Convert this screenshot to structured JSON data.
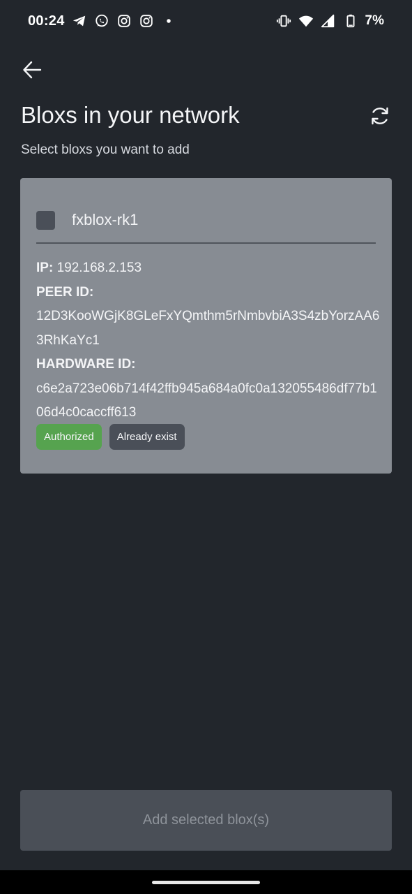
{
  "status_bar": {
    "time": "00:24",
    "left_icons": [
      "telegram-icon",
      "whatsapp-icon",
      "instagram-icon",
      "instagram-icon",
      "dot-icon"
    ],
    "right_icons": [
      "vibrate-icon",
      "wifi-icon",
      "signal-icon",
      "battery-icon"
    ],
    "battery": "7%"
  },
  "header": {
    "title": "Bloxs in your network",
    "subtitle": "Select bloxs you want to add"
  },
  "blox": {
    "name": "fxblox-rk1",
    "checked": false,
    "ip_label": "IP:",
    "ip": "192.168.2.153",
    "peer_label": "PEER ID:",
    "peer_id": "12D3KooWGjK8GLeFxYQmthm5rNmbvbiA3S4zbYorzAA63RhKaYc1",
    "hw_label": "HARDWARE ID:",
    "hardware_id": "c6e2a723e06b714f42ffb945a684a0fc0a132055486df77b106d4c0caccff613",
    "tags": [
      "Authorized",
      "Already exist"
    ]
  },
  "footer": {
    "add_button": "Add selected blox(s)"
  },
  "colors": {
    "background": "#22262c",
    "card": "#878c93",
    "authorized": "#56a34f",
    "button_disabled": "#4a4f57"
  }
}
